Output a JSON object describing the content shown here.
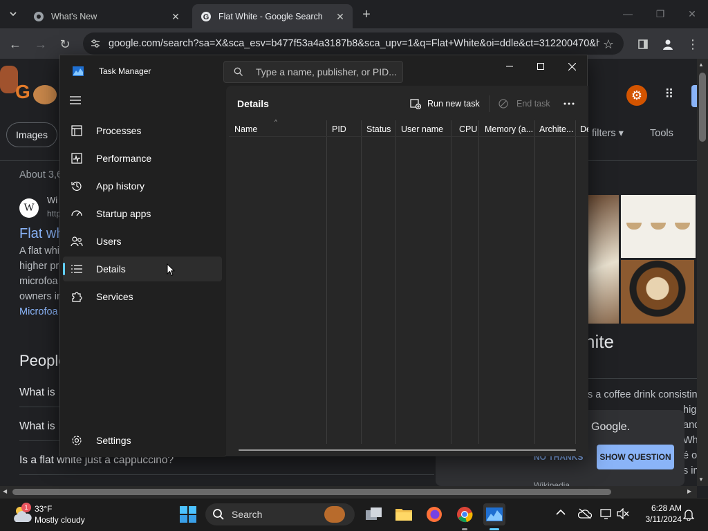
{
  "browser": {
    "tabs": [
      {
        "title": "What's New"
      },
      {
        "title": "Flat White - Google Search"
      }
    ],
    "url": "google.com/search?sa=X&sca_esv=b477f53a4a3187b8&sca_upv=1&q=Flat+White&oi=ddle&ct=312200470&hl..."
  },
  "page": {
    "nav_images": "Images",
    "filters": "filters",
    "tools": "Tools",
    "about": "About 3,6",
    "wiki_source": "Wi",
    "wiki_url": "http",
    "result_title": "Flat wh",
    "result_snippet": [
      "A flat whi",
      "higher pro",
      "microfoa",
      "owners in",
      "Microfoa"
    ],
    "people": "People",
    "q1": "What is",
    "q2": "What is",
    "q3": "Is a flat white just a cappuccino?",
    "kp_title": "hite",
    "kp_desc": [
      "s a coffee drink consisting",
      "higl",
      "and",
      "Whil",
      "é o",
      "s in"
    ],
    "google_promo": "Google.",
    "no_thanks": "NO THANKS",
    "show_question": "SHOW QUESTION",
    "wikipedia": "Wikipedia"
  },
  "taskmanager": {
    "title": "Task Manager",
    "search_placeholder": "Type a name, publisher, or PID...",
    "nav": [
      "Processes",
      "Performance",
      "App history",
      "Startup apps",
      "Users",
      "Details",
      "Services"
    ],
    "settings": "Settings",
    "page_title": "Details",
    "run_new_task": "Run new task",
    "end_task": "End task",
    "columns": [
      "Name",
      "PID",
      "Status",
      "User name",
      "CPU",
      "Memory (a...",
      "Archite...",
      "De"
    ]
  },
  "taskbar": {
    "weather_temp": "33°F",
    "weather_desc": "Mostly cloudy",
    "weather_badge": "1",
    "search": "Search",
    "time": "6:28 AM",
    "date": "3/11/2024"
  },
  "colors": {
    "accent": "#60cdff",
    "google_blue": "#8ab4f8",
    "show_question_bg": "#8ab4f8"
  }
}
